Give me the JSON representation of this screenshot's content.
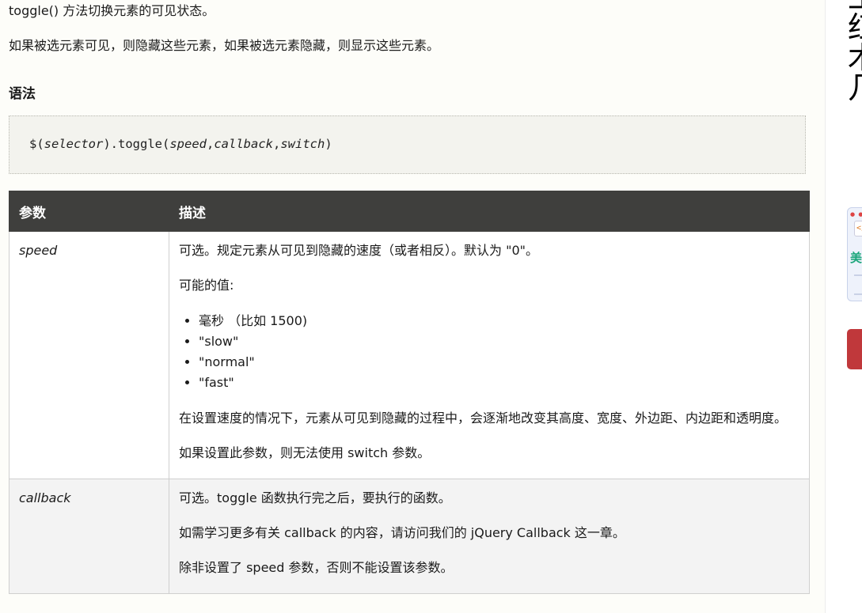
{
  "intro": {
    "line1": "toggle() 方法切换元素的可见状态。",
    "line2": "如果被选元素可见，则隐藏这些元素，如果被选元素隐藏，则显示这些元素。"
  },
  "syntax": {
    "heading": "语法",
    "prefix": "$(",
    "selector": "selector",
    "middle": ").toggle(",
    "arg1": "speed",
    "comma1": ",",
    "arg2": "callback",
    "comma2": ",",
    "arg3": "switch",
    "suffix": ")"
  },
  "table": {
    "headers": [
      "参数",
      "描述"
    ],
    "rows": [
      {
        "name": "speed",
        "desc1": "可选。规定元素从可见到隐藏的速度（或者相反）。默认为 \"0\"。",
        "desc2": "可能的值:",
        "values": [
          "毫秒 （比如 1500)",
          "\"slow\"",
          "\"normal\"",
          "\"fast\""
        ],
        "desc3": "在设置速度的情况下，元素从可见到隐藏的过程中，会逐渐地改变其高度、宽度、外边距、内边距和透明度。",
        "desc4": "如果设置此参数，则无法使用 switch 参数。"
      },
      {
        "name": "callback",
        "desc1": "可选。toggle 函数执行完之后，要执行的函数。",
        "desc2": "如需学习更多有关 callback 的内容，请访问我们的 jQuery Callback 这一章。",
        "desc3": "除非设置了 speed 参数，否则不能设置该参数。"
      }
    ]
  },
  "sidebar": {
    "glyphs": [
      "工",
      "红",
      "木",
      "几"
    ],
    "promo_tag": "</>",
    "promo_text": "美",
    "colors": {
      "button": "#c0383b",
      "promo_text": "#1aa57a"
    }
  }
}
